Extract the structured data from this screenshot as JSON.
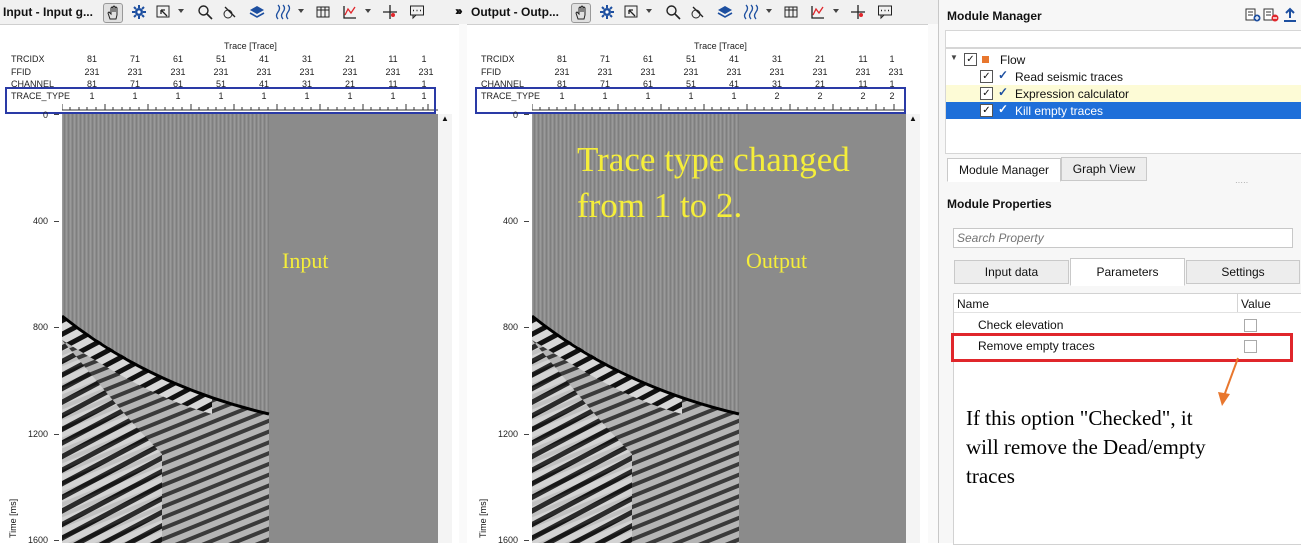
{
  "input_panel": {
    "title": "Input - Input g...",
    "axis_title": "Trace [Trace]",
    "headers": [
      {
        "label": "TRCIDX",
        "values": [
          "81",
          "71",
          "61",
          "51",
          "41",
          "31",
          "21",
          "11",
          "1"
        ]
      },
      {
        "label": "FFID",
        "values": [
          "231",
          "231",
          "231",
          "231",
          "231",
          "231",
          "231",
          "231",
          "231"
        ]
      },
      {
        "label": "CHANNEL",
        "values": [
          "81",
          "71",
          "61",
          "51",
          "41",
          "31",
          "21",
          "11",
          "1"
        ]
      },
      {
        "label": "TRACE_TYPE",
        "values": [
          "1",
          "1",
          "1",
          "1",
          "1",
          "1",
          "1",
          "1",
          "1"
        ]
      }
    ],
    "y_ticks": [
      "0",
      "400",
      "800",
      "1200",
      "1600"
    ],
    "y_label": "Time [ms]",
    "overlay_label": "Input"
  },
  "output_panel": {
    "title": "Output - Outp...",
    "axis_title": "Trace [Trace]",
    "headers": [
      {
        "label": "TRCIDX",
        "values": [
          "81",
          "71",
          "61",
          "51",
          "41",
          "31",
          "21",
          "11",
          "1"
        ]
      },
      {
        "label": "FFID",
        "values": [
          "231",
          "231",
          "231",
          "231",
          "231",
          "231",
          "231",
          "231",
          "231"
        ]
      },
      {
        "label": "CHANNEL",
        "values": [
          "81",
          "71",
          "61",
          "51",
          "41",
          "31",
          "21",
          "11",
          "1"
        ]
      },
      {
        "label": "TRACE_TYPE",
        "values": [
          "1",
          "1",
          "1",
          "1",
          "1",
          "2",
          "2",
          "2",
          "2"
        ]
      }
    ],
    "y_ticks": [
      "0",
      "400",
      "800",
      "1200",
      "1600"
    ],
    "y_label": "Time [ms]",
    "overlay_label": "Output",
    "annotation_line1": "Trace type changed",
    "annotation_line2": "from 1 to 2."
  },
  "module_manager": {
    "title": "Module Manager",
    "tree": [
      {
        "label": "Flow",
        "checked": true
      },
      {
        "label": "Read seismic traces",
        "checked": true
      },
      {
        "label": "Expression calculator",
        "checked": true
      },
      {
        "label": "Kill empty traces",
        "checked": true,
        "selected": true
      }
    ],
    "tabs": [
      "Module Manager",
      "Graph View"
    ]
  },
  "module_properties": {
    "title": "Module Properties",
    "search_placeholder": "Search Property",
    "tabs": [
      "Input data",
      "Parameters",
      "Settings"
    ],
    "columns": [
      "Name",
      "Value"
    ],
    "rows": [
      {
        "name": "Check elevation",
        "checked": false
      },
      {
        "name": "Remove empty traces",
        "checked": false
      }
    ],
    "annotation_line1": "If this option \"Checked\", it",
    "annotation_line2": "will remove the Dead/empty",
    "annotation_line3": "traces"
  },
  "colors": {
    "accent_blue": "#2a3aa6",
    "highlight_red": "#e0262b",
    "annotation_yellow": "#f5ee3a",
    "arrow_orange": "#e8772e",
    "selected_row": "#1e6fd9",
    "hover_row": "#fdfbd6"
  }
}
